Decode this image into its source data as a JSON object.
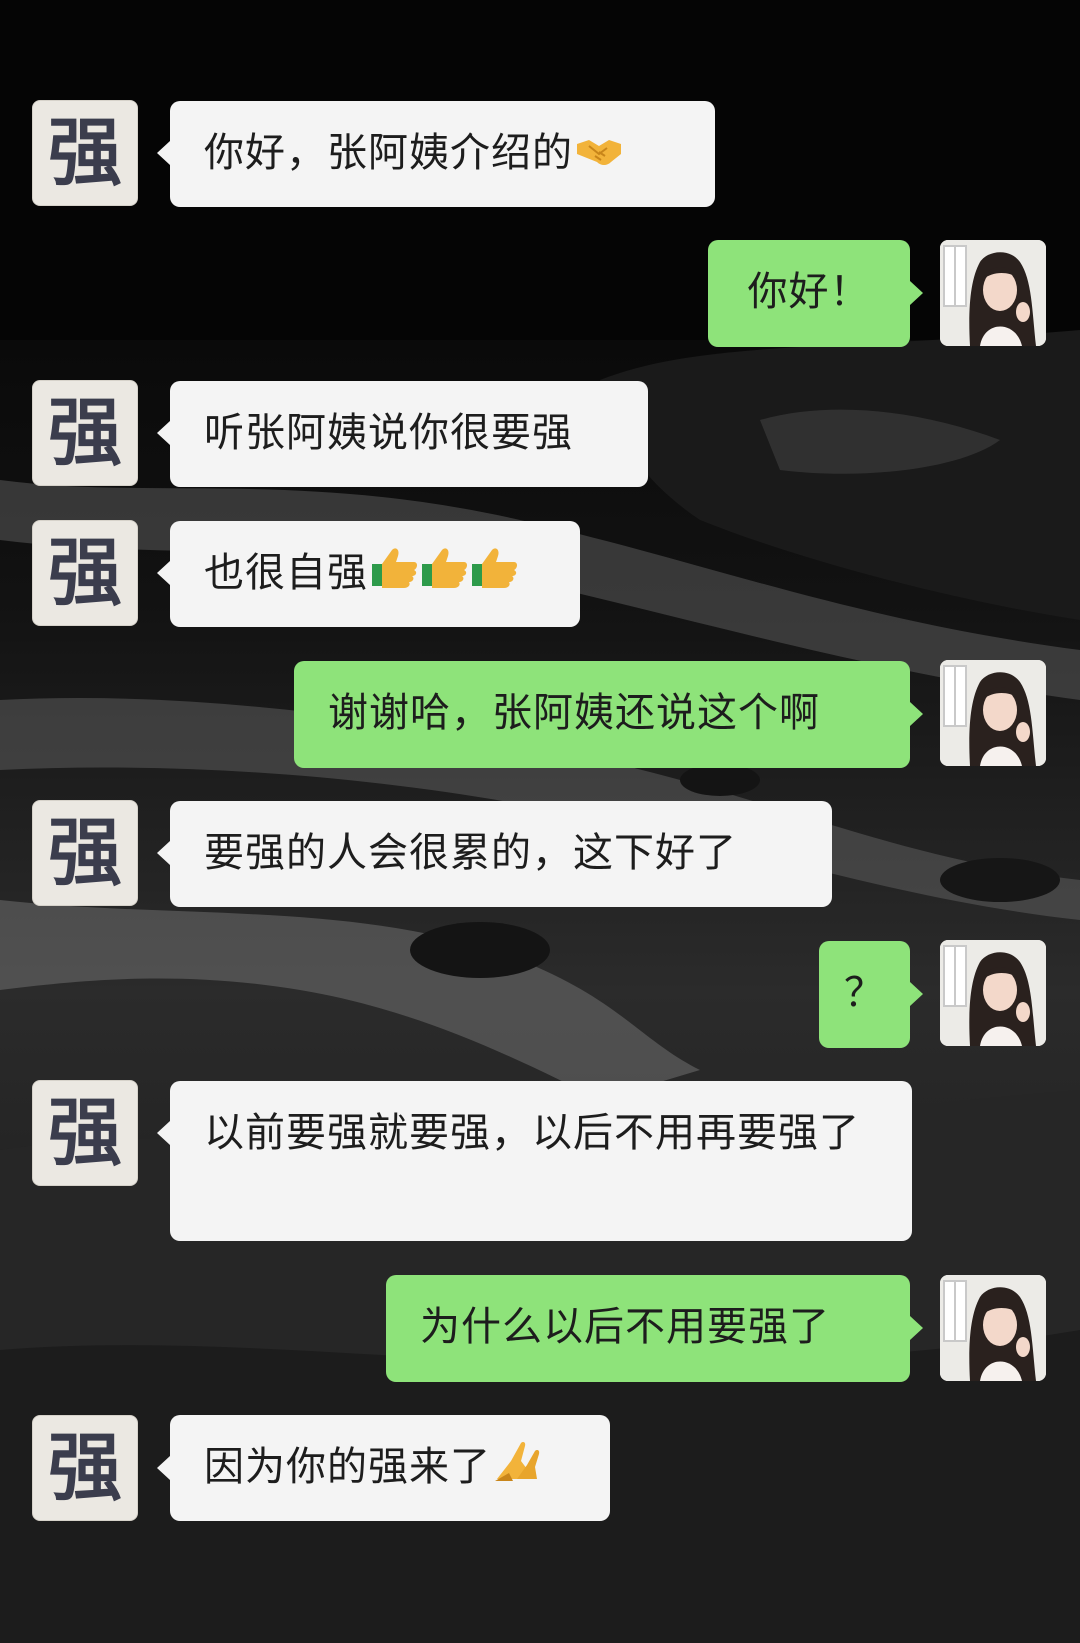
{
  "chat": {
    "messages": [
      {
        "side": "left",
        "sender_avatar": "强",
        "text": "你好，张阿姨介绍的",
        "emoji": "handshake-icon"
      },
      {
        "side": "right",
        "text": "你好！"
      },
      {
        "side": "left",
        "sender_avatar": "强",
        "text": "听张阿姨说你很要强"
      },
      {
        "side": "left",
        "sender_avatar": "强",
        "text": "也很自强",
        "emoji": "thumbs-up-icon x3"
      },
      {
        "side": "right",
        "text": "谢谢哈，张阿姨还说这个啊"
      },
      {
        "side": "left",
        "sender_avatar": "强",
        "text": "要强的人会很累的，这下好了"
      },
      {
        "side": "right",
        "text": "？"
      },
      {
        "side": "left",
        "sender_avatar": "强",
        "text": "以前要强就要强，以后不用再要强了"
      },
      {
        "side": "right",
        "text": "为什么以后不用要强了"
      },
      {
        "side": "left",
        "sender_avatar": "强",
        "text": "因为你的强来了",
        "emoji": "praying-hands-icon"
      }
    ]
  },
  "colors": {
    "left_bubble": "#f4f4f4",
    "right_bubble": "#8ee37a",
    "background": "#050505"
  }
}
